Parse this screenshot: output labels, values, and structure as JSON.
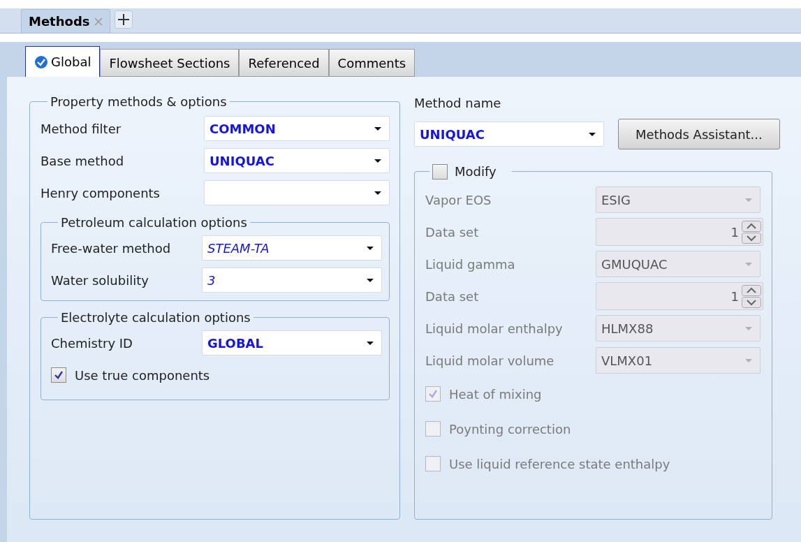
{
  "document_tabs": [
    {
      "label": "Methods",
      "selected": true,
      "closable": true
    }
  ],
  "tabs": [
    {
      "label": "Global",
      "selected": true,
      "complete": true
    },
    {
      "label": "Flowsheet Sections",
      "selected": false,
      "complete": false
    },
    {
      "label": "Referenced",
      "selected": false,
      "complete": false
    },
    {
      "label": "Comments",
      "selected": false,
      "complete": false
    }
  ],
  "property_methods": {
    "title": "Property methods & options",
    "fields": [
      {
        "label": "Method filter",
        "value": "COMMON",
        "default": false
      },
      {
        "label": "Base method",
        "value": "UNIQUAC",
        "default": false
      },
      {
        "label": "Henry components"
      }
    ],
    "petroleum": {
      "title": "Petroleum calculation options",
      "fields": [
        {
          "label": "Free-water method",
          "value": "STEAM-TA",
          "default": true
        },
        {
          "label": "Water solubility",
          "value": "3",
          "default": true
        }
      ]
    },
    "electrolyte": {
      "title": "Electrolyte calculation options",
      "fields": [
        {
          "label": "Chemistry ID",
          "value": "GLOBAL",
          "default": false
        }
      ],
      "checkbox": {
        "label": "Use true components",
        "checked": true
      }
    }
  },
  "method_name": {
    "label": "Method name",
    "value": "UNIQUAC",
    "default": false
  },
  "assistant_button": "Methods Assistant...",
  "modify": {
    "label": "Modify",
    "checked": false,
    "fields": [
      {
        "kind": "combo",
        "label": "Vapor EOS",
        "value": "ESIG",
        "disabled": true
      },
      {
        "kind": "spinner",
        "label": "Data set",
        "value": "1",
        "disabled": true
      },
      {
        "kind": "combo",
        "label": "Liquid gamma",
        "value": "GMUQUAC",
        "disabled": true
      },
      {
        "kind": "spinner",
        "label": "Data set",
        "value": "1",
        "disabled": true
      },
      {
        "kind": "combo",
        "label": "Liquid molar enthalpy",
        "value": "HLMX88",
        "disabled": true
      },
      {
        "kind": "combo",
        "label": "Liquid molar volume",
        "value": "VLMX01",
        "disabled": true
      }
    ],
    "checkboxes": [
      {
        "label": "Heat of mixing",
        "checked": true,
        "disabled": true
      },
      {
        "label": "Poynting correction",
        "checked": false,
        "disabled": true
      },
      {
        "label": "Use liquid reference state enthalpy",
        "checked": false,
        "disabled": true
      }
    ]
  }
}
